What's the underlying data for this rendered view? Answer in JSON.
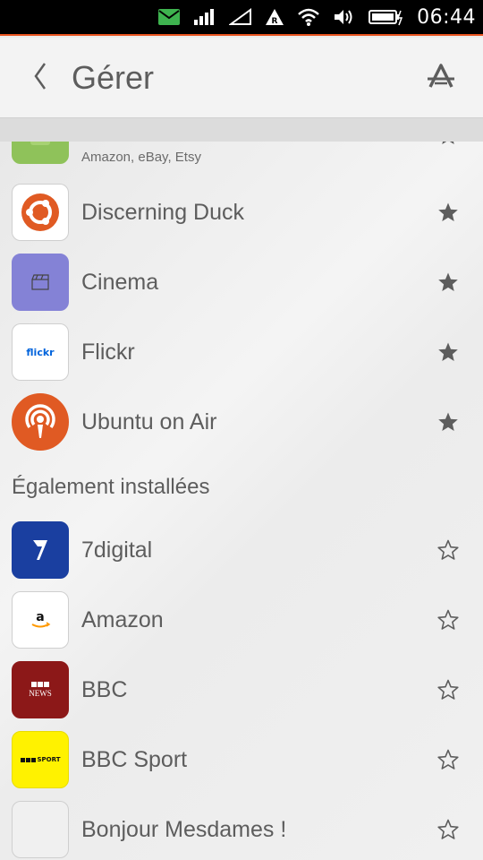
{
  "status_bar": {
    "time": "06:44",
    "icons": [
      "mail-icon",
      "signal-icon",
      "signal-empty-icon",
      "roaming-icon",
      "wifi-icon",
      "volume-icon",
      "battery-icon"
    ]
  },
  "header": {
    "title": "Gérer",
    "back_icon": "chevron-left-icon",
    "store_icon": "store-icon"
  },
  "favorites": [
    {
      "name": "",
      "subtitle": "Amazon, eBay, Etsy",
      "icon": "shopping-icon",
      "color": "#8fc25a",
      "favorite": true
    },
    {
      "name": "Discerning Duck",
      "icon": "ubuntu-icon",
      "color": "#ffffff",
      "favorite": true
    },
    {
      "name": "Cinema",
      "icon": "clapper-icon",
      "color": "#8482d6",
      "favorite": true
    },
    {
      "name": "Flickr",
      "icon": "flickr-icon",
      "color": "#ffffff",
      "favorite": true
    },
    {
      "name": "Ubuntu on Air",
      "icon": "podcast-icon",
      "color": "#e05a23",
      "favorite": true
    }
  ],
  "installed_section": {
    "title": "Également installées"
  },
  "installed": [
    {
      "name": "7digital",
      "icon": "7digital-icon",
      "color": "#1a3fa0",
      "favorite": false
    },
    {
      "name": "Amazon",
      "icon": "amazon-icon",
      "color": "#ffffff",
      "favorite": false
    },
    {
      "name": "BBC",
      "icon": "bbc-news-icon",
      "color": "#8c1818",
      "favorite": false
    },
    {
      "name": "BBC Sport",
      "icon": "bbc-sport-icon",
      "color": "#fff200",
      "favorite": false
    },
    {
      "name": "Bonjour Mesdames !",
      "icon": "bonjour-icon",
      "color": "#f0f0f0",
      "favorite": false
    }
  ],
  "icon_text": {
    "flickr": "flickr",
    "bbc_news": "NEWS",
    "bbc_sport": "SPORT"
  },
  "colors": {
    "accent": "#e95420",
    "star_filled": "#5d5d5d",
    "text": "#5d5d5d"
  }
}
